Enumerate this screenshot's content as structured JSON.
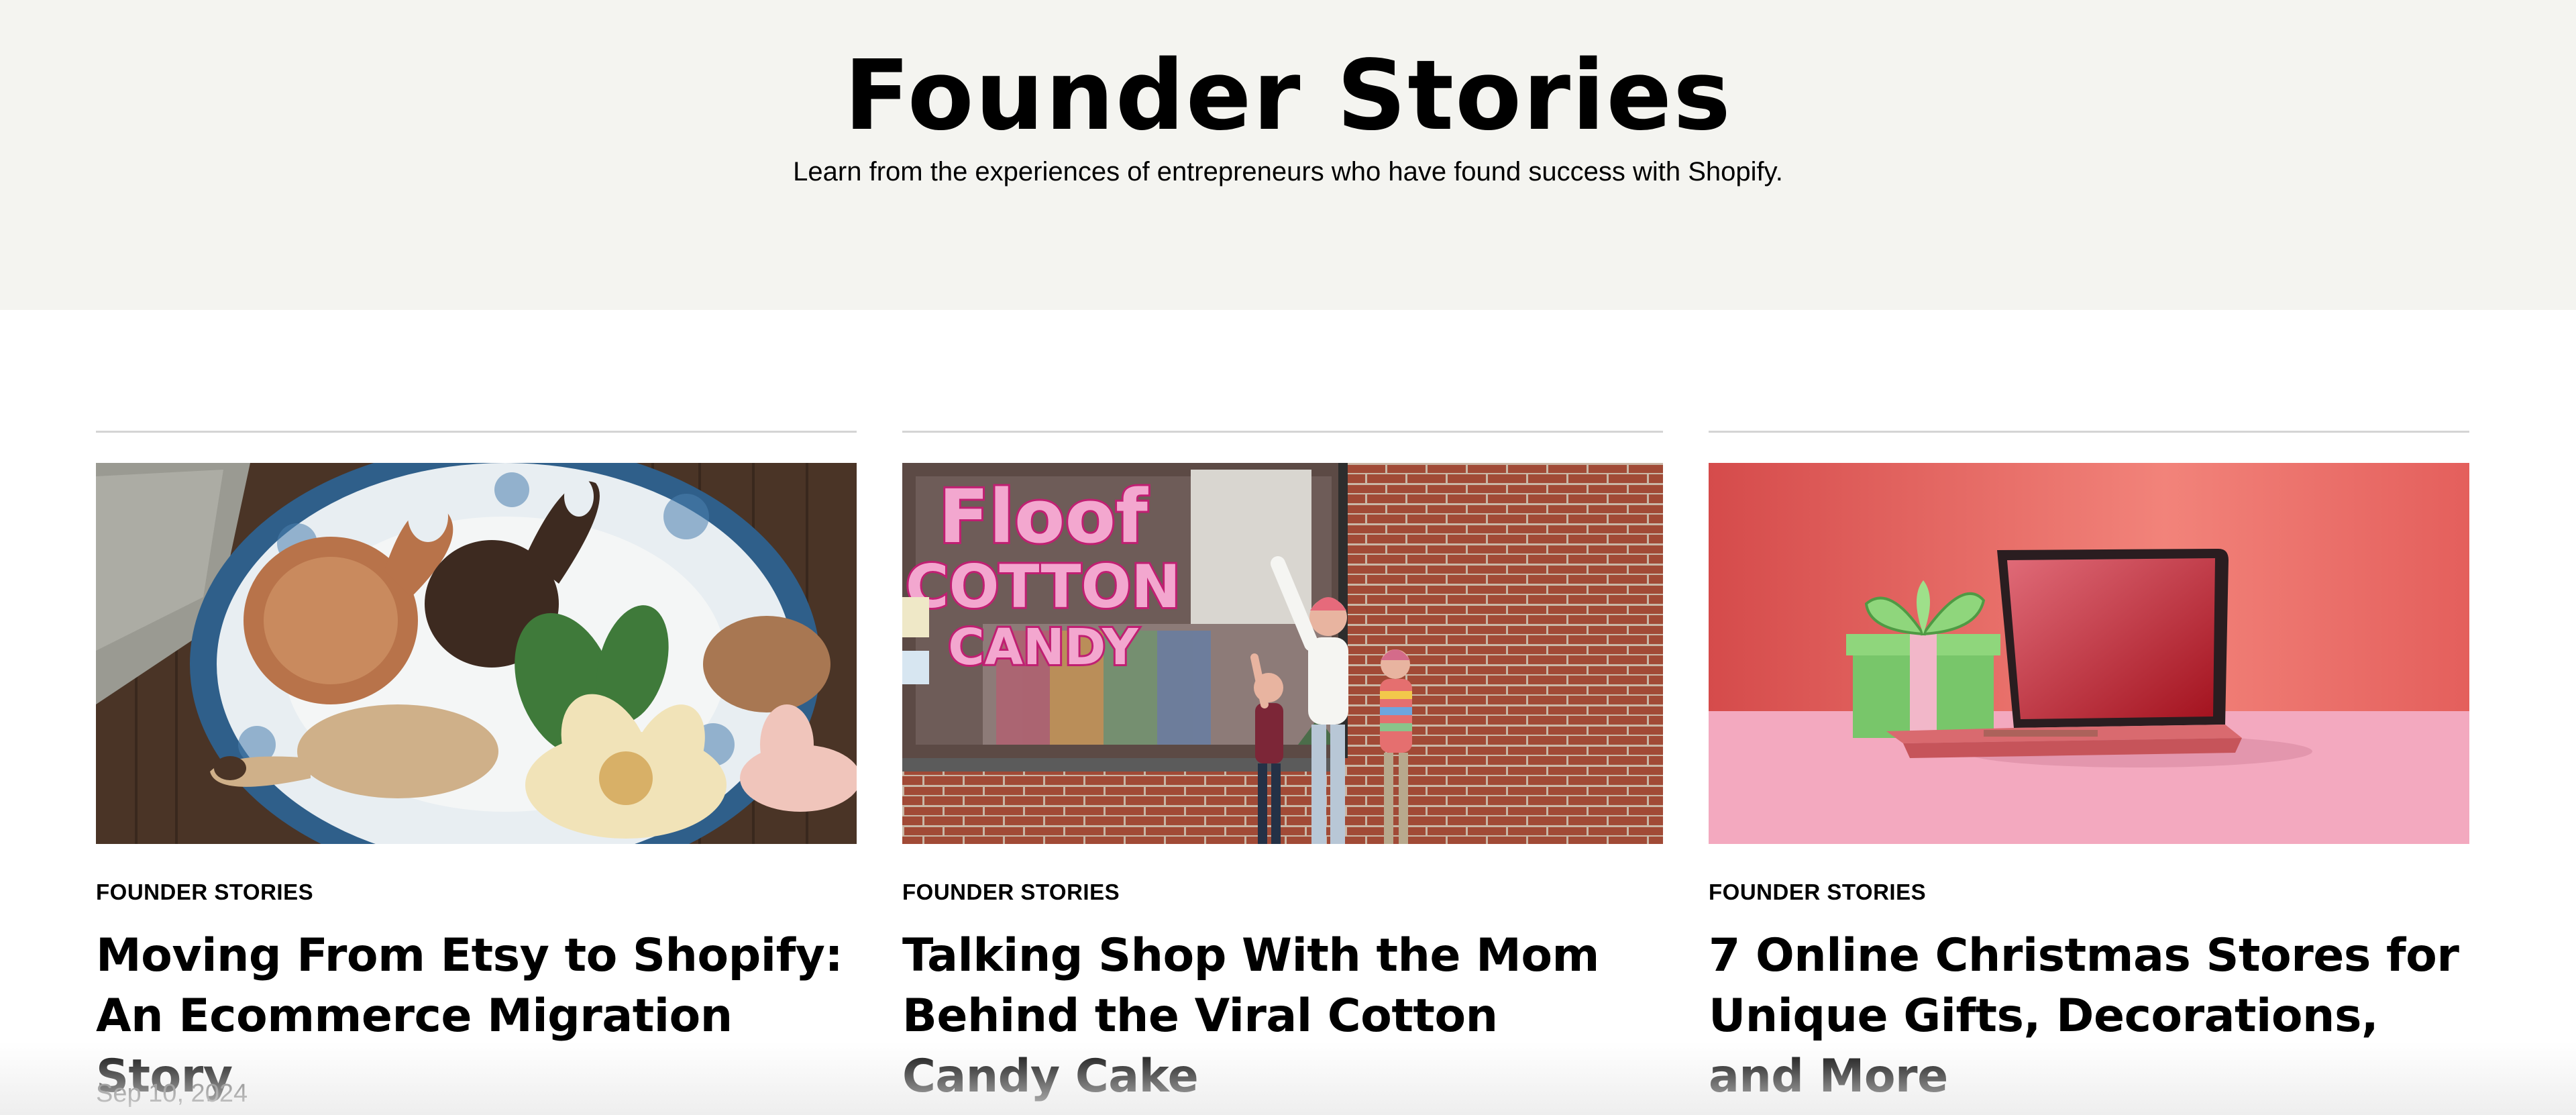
{
  "hero": {
    "title": "Founder Stories",
    "subtitle": "Learn from the experiences of entrepreneurs who have found success with Shopify."
  },
  "cards": [
    {
      "category": "FOUNDER STORIES",
      "title": "Moving From Etsy to Shopify: An Ecommerce Migration Story",
      "date": "Sep 10, 2024",
      "image": "wooden-spoons-on-plate-photo"
    },
    {
      "category": "FOUNDER STORIES",
      "title": "Talking Shop With the Mom Behind the Viral Cotton Candy Cake",
      "date": "",
      "image": "floof-cotton-candy-storefront-photo",
      "image_sign_text": [
        "Floof",
        "COTTON",
        "CANDY"
      ]
    },
    {
      "category": "FOUNDER STORIES",
      "title": "7 Online Christmas Stores for Unique Gifts, Decorations, and More",
      "date": "",
      "image": "gift-box-and-laptop-illustration"
    }
  ],
  "colors": {
    "hero_background": "#f4f4f0",
    "divider": "#d4d4d4",
    "date_text": "#555555"
  }
}
